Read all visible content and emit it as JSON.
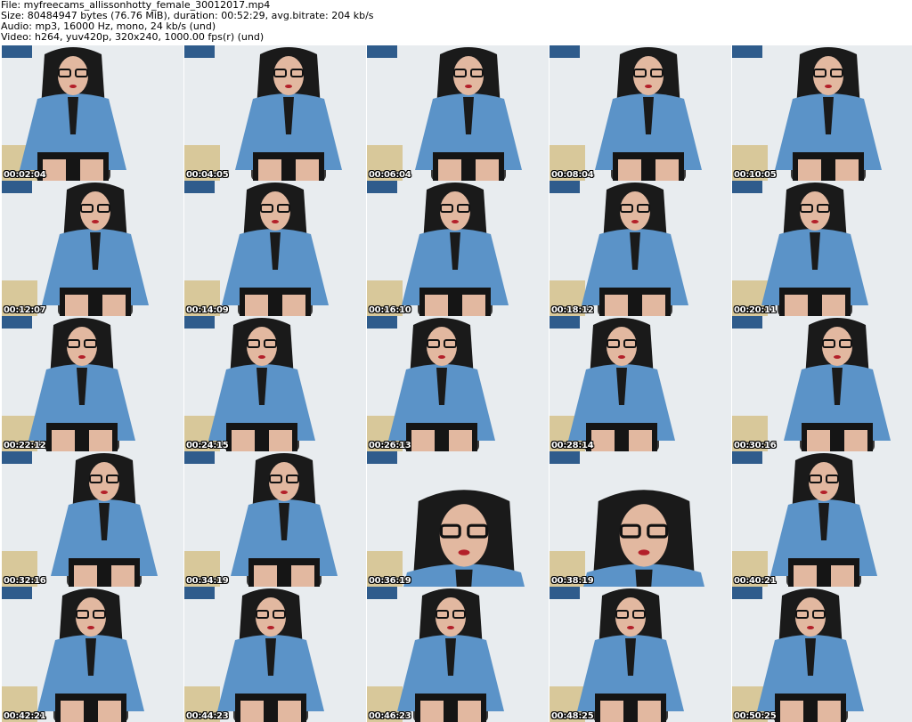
{
  "header": {
    "file": "File: myfreecams_allissonhotty_female_30012017.mp4",
    "size": "Size: 80484947 bytes (76.76 MiB), duration: 00:52:29, avg.bitrate: 204 kb/s",
    "audio": "Audio: mp3, 16000 Hz, mono, 24 kb/s (und)",
    "video": "Video: h264, yuv420p, 320x240, 1000.00 fps(r) (und)"
  },
  "thumbnails": [
    {
      "timestamp": "00:02:04"
    },
    {
      "timestamp": "00:04:05"
    },
    {
      "timestamp": "00:06:04"
    },
    {
      "timestamp": "00:08:04"
    },
    {
      "timestamp": "00:10:05"
    },
    {
      "timestamp": "00:12:07"
    },
    {
      "timestamp": "00:14:09"
    },
    {
      "timestamp": "00:16:10"
    },
    {
      "timestamp": "00:18:12"
    },
    {
      "timestamp": "00:20:11"
    },
    {
      "timestamp": "00:22:12"
    },
    {
      "timestamp": "00:24:15"
    },
    {
      "timestamp": "00:26:13"
    },
    {
      "timestamp": "00:28:14"
    },
    {
      "timestamp": "00:30:16"
    },
    {
      "timestamp": "00:32:16"
    },
    {
      "timestamp": "00:34:19"
    },
    {
      "timestamp": "00:36:19"
    },
    {
      "timestamp": "00:38:19"
    },
    {
      "timestamp": "00:40:21"
    },
    {
      "timestamp": "00:42:21"
    },
    {
      "timestamp": "00:44:23"
    },
    {
      "timestamp": "00:46:23"
    },
    {
      "timestamp": "00:48:25"
    },
    {
      "timestamp": "00:50:25"
    }
  ],
  "colors": {
    "wall": "#e8ecef",
    "shirt": "#5b93c8",
    "shirt_shadow": "#3f73a6",
    "hair": "#1a1a1a",
    "skirt": "#151515",
    "skin": "#e2b8a0",
    "chair": "#3c3c3c",
    "desk": "#d8c89a",
    "sign": "#2f5c8c"
  }
}
